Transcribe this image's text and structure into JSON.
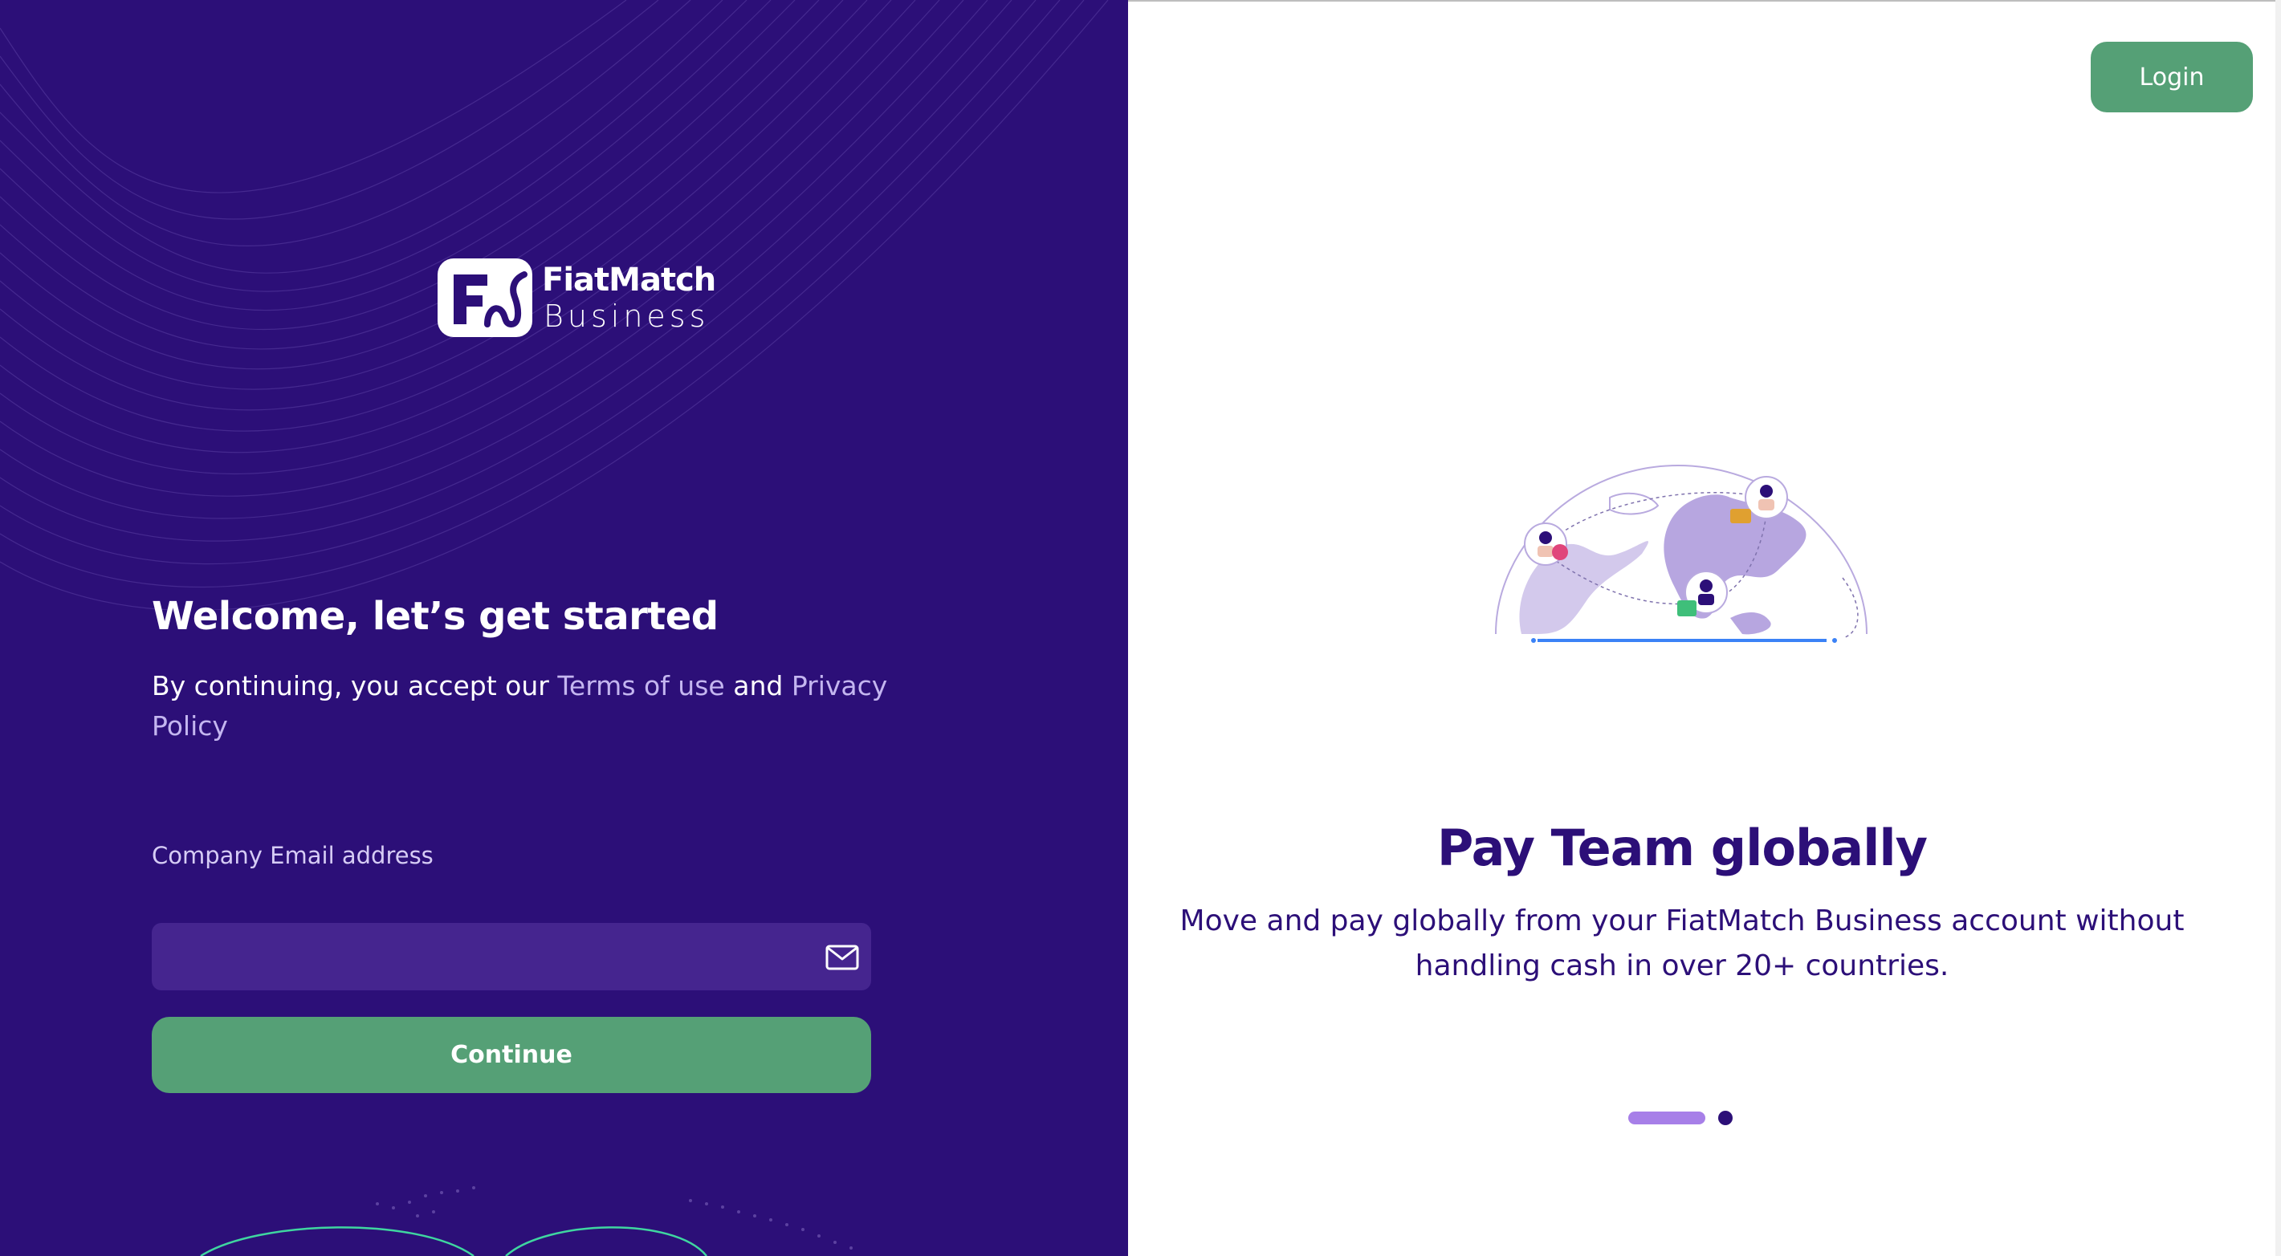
{
  "brand": {
    "name_line1": "FiatMatch",
    "name_line2": "Business"
  },
  "signup": {
    "heading": "Welcome, let’s get started",
    "terms_prefix": "By continuing, you accept our ",
    "terms_link": "Terms of use",
    "terms_and": " and ",
    "privacy_link": "Privacy Policy",
    "email_label": "Company Email address",
    "email_value": "",
    "email_placeholder": "",
    "continue_label": "Continue"
  },
  "header": {
    "login_label": "Login"
  },
  "carousel": {
    "title": "Pay Team globally",
    "description": "Move and pay globally from your FiatMatch Business account without handling cash in over 20+ countries.",
    "active_slide": 1,
    "slide_count": 2
  },
  "colors": {
    "panel_bg": "#2c0f78",
    "accent_green": "#55a076",
    "link": "#c4b6f0",
    "indicator_active": "#a77fe8"
  },
  "icons": {
    "email_field": "mail-icon",
    "logo": "fiatmatch-logo-icon"
  }
}
